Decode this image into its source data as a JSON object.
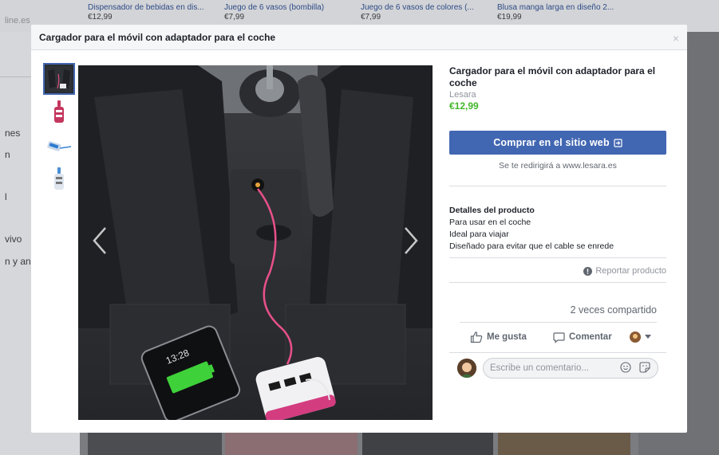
{
  "background": {
    "brand_fragment": "line.es",
    "products": [
      {
        "title": "Dispensador de bebidas en dis...",
        "price": "€12,99"
      },
      {
        "title": "Juego de 6 vasos (bombilla)",
        "price": "€7,99"
      },
      {
        "title": "Juego de 6 vasos de colores (...",
        "price": "€7,99"
      },
      {
        "title": "Blusa manga larga en diseño 2...",
        "price": "€19,99"
      }
    ],
    "sidebar_fragments": [
      "nes",
      "n",
      "l",
      "vivo",
      "n y an"
    ]
  },
  "modal": {
    "title": "Cargador para el móvil con adaptador para el coche",
    "close_glyph": "×",
    "thumbnails": [
      "car-interior",
      "pink-adapter",
      "cable-hub",
      "blue-adapter"
    ],
    "photo": {
      "phone_time": "13:28"
    },
    "product": {
      "title": "Cargador para el móvil con adaptador para el coche",
      "seller": "Lesara",
      "price": "€12,99",
      "buy_label": "Comprar en el sitio web",
      "redirect_note": "Se te redirigirá a www.lesara.es",
      "details_heading": "Detalles del producto",
      "details": [
        "Para usar en el coche",
        "Ideal para viajar",
        "Diseñado para evitar que el cable se enrede"
      ],
      "report_label": "Reportar producto",
      "shares": "2 veces compartido",
      "like_label": "Me gusta",
      "comment_label": "Comentar",
      "comment_placeholder": "Escribe un comentario..."
    },
    "colors": {
      "accent": "#4267b2",
      "price": "#42b72a"
    }
  }
}
